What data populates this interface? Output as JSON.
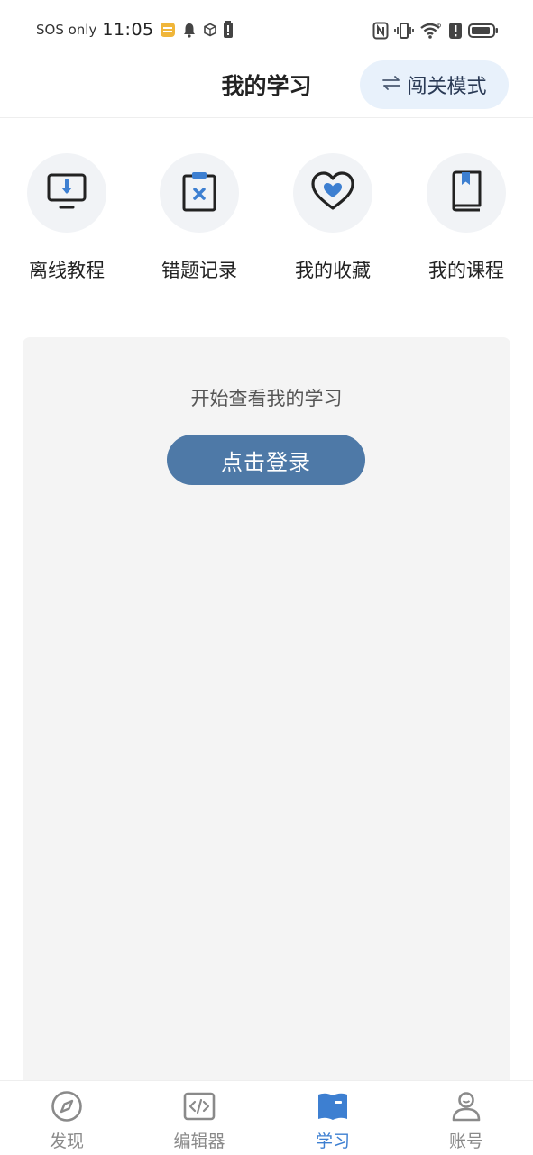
{
  "status_bar": {
    "carrier": "SOS only",
    "time": "11:05"
  },
  "header": {
    "title": "我的学习",
    "mode_button_label": "闯关模式"
  },
  "quick_actions": [
    {
      "label": "离线教程",
      "icon": "offline-download-icon"
    },
    {
      "label": "错题记录",
      "icon": "wrong-answer-clipboard-icon"
    },
    {
      "label": "我的收藏",
      "icon": "heart-icon"
    },
    {
      "label": "我的课程",
      "icon": "book-icon"
    }
  ],
  "login_card": {
    "hint": "开始查看我的学习",
    "button_label": "点击登录"
  },
  "bottom_nav": {
    "items": [
      {
        "label": "发现",
        "icon": "compass-icon"
      },
      {
        "label": "编辑器",
        "icon": "code-editor-icon"
      },
      {
        "label": "学习",
        "icon": "open-book-icon",
        "active": true
      },
      {
        "label": "账号",
        "icon": "user-icon"
      }
    ]
  },
  "colors": {
    "accent": "#3d7fd1",
    "login_button": "#4e79a7",
    "mode_button_bg": "#e8f1fb",
    "card_bg": "#f4f4f4",
    "icon_circle_bg": "#f1f3f6"
  }
}
